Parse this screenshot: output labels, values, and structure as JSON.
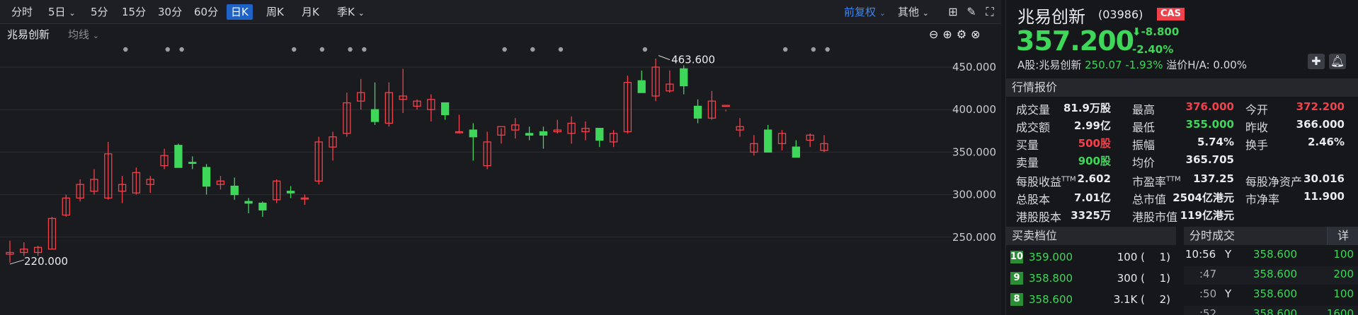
{
  "toolbar": {
    "periods": [
      "分时",
      "5日",
      "5分",
      "15分",
      "30分",
      "60分",
      "日K",
      "周K",
      "月K",
      "季K"
    ],
    "active": "日K",
    "adjust": "前复权",
    "other": "其他"
  },
  "chart": {
    "name": "兆易创新",
    "indicator": "均线",
    "yticks": [
      "450.000",
      "400.000",
      "350.000",
      "300.000",
      "250.000"
    ],
    "high_label": "463.600",
    "low_label": "220.000",
    "candles": [
      [
        230,
        246,
        220,
        232
      ],
      [
        232,
        244,
        228,
        236
      ],
      [
        232,
        240,
        228,
        238
      ],
      [
        236,
        274,
        236,
        272
      ],
      [
        276,
        300,
        274,
        296
      ],
      [
        296,
        318,
        292,
        312
      ],
      [
        304,
        330,
        300,
        318
      ],
      [
        296,
        362,
        294,
        348
      ],
      [
        304,
        322,
        290,
        312
      ],
      [
        302,
        332,
        300,
        326
      ],
      [
        312,
        322,
        302,
        318
      ],
      [
        334,
        354,
        330,
        346
      ],
      [
        358,
        360,
        336,
        332
      ],
      [
        338,
        345,
        330,
        337
      ],
      [
        332,
        336,
        300,
        310
      ],
      [
        312,
        322,
        306,
        316
      ],
      [
        310,
        320,
        294,
        300
      ],
      [
        292,
        296,
        278,
        290
      ],
      [
        290,
        292,
        274,
        282
      ],
      [
        294,
        318,
        290,
        316
      ],
      [
        304,
        310,
        296,
        302
      ],
      [
        296,
        300,
        288,
        296
      ],
      [
        316,
        368,
        312,
        362
      ],
      [
        356,
        374,
        340,
        368
      ],
      [
        372,
        420,
        368,
        408
      ],
      [
        410,
        436,
        400,
        420
      ],
      [
        400,
        432,
        382,
        386
      ],
      [
        384,
        432,
        380,
        420
      ],
      [
        412,
        448,
        396,
        416
      ],
      [
        404,
        412,
        400,
        410
      ],
      [
        400,
        418,
        386,
        412
      ],
      [
        408,
        408,
        388,
        394
      ],
      [
        374,
        394,
        372,
        374
      ],
      [
        376,
        384,
        340,
        368
      ],
      [
        334,
        374,
        330,
        362
      ],
      [
        370,
        378,
        360,
        380
      ],
      [
        376,
        390,
        366,
        382
      ],
      [
        372,
        380,
        364,
        370
      ],
      [
        374,
        380,
        354,
        370
      ],
      [
        374,
        388,
        372,
        376
      ],
      [
        372,
        392,
        360,
        384
      ],
      [
        374,
        386,
        364,
        378
      ],
      [
        378,
        374,
        356,
        364
      ],
      [
        362,
        376,
        356,
        372
      ],
      [
        374,
        440,
        372,
        432
      ],
      [
        434,
        446,
        420,
        420
      ],
      [
        416,
        460,
        410,
        450
      ],
      [
        422,
        446,
        420,
        430
      ],
      [
        448,
        452,
        418,
        428
      ],
      [
        404,
        412,
        384,
        390
      ],
      [
        390,
        422,
        388,
        410
      ],
      [
        405,
        400,
        398,
        405
      ],
      [
        376,
        390,
        368,
        380
      ],
      [
        350,
        370,
        346,
        360
      ],
      [
        376,
        382,
        350,
        350
      ],
      [
        360,
        376,
        352,
        372
      ],
      [
        356,
        364,
        346,
        344
      ],
      [
        364,
        372,
        356,
        370
      ],
      [
        352,
        370,
        350,
        360
      ]
    ]
  },
  "quote": {
    "name": "兆易创新",
    "code": "(03986)",
    "badge": "CAS",
    "price": "357.200",
    "change": "-8.800",
    "change_pct": "-2.40%",
    "a_share": "A股:兆易创新",
    "a_price": "250.07",
    "a_pct": "-1.93%",
    "premium": "溢价H/A: 0.00%"
  },
  "market": {
    "title": "行情报价",
    "rows": [
      [
        [
          "成交量",
          "81.9万股",
          "white"
        ],
        [
          "最高",
          "376.000",
          "red"
        ],
        [
          "今开",
          "372.200",
          "red"
        ]
      ],
      [
        [
          "成交额",
          "2.99亿",
          "white"
        ],
        [
          "最低",
          "355.000",
          "green"
        ],
        [
          "昨收",
          "366.000",
          "white"
        ]
      ],
      [
        [
          "买量",
          "500股",
          "red"
        ],
        [
          "振幅",
          "5.74%",
          "white"
        ],
        [
          "换手",
          "2.46%",
          "white"
        ]
      ],
      [
        [
          "卖量",
          "900股",
          "green"
        ],
        [
          "均价",
          "365.705",
          "white"
        ],
        [
          "",
          "",
          " "
        ]
      ]
    ],
    "fund_rows": [
      [
        [
          "每股收益",
          "2.602"
        ],
        [
          "市盈率",
          "137.25"
        ],
        [
          "每股净资产",
          "30.016"
        ]
      ],
      [
        [
          "总股本",
          "7.01亿"
        ],
        [
          "总市值",
          "2504亿港元"
        ],
        [
          "市净率",
          "11.900"
        ]
      ],
      [
        [
          "港股股本",
          "3325万"
        ],
        [
          "港股市值",
          "119亿港元"
        ],
        [
          "",
          ""
        ]
      ]
    ],
    "ttm": "TTM"
  },
  "orderbook": {
    "title": "买卖档位",
    "rows": [
      {
        "level": "10",
        "price": "359.000",
        "vol": "100 (",
        "cnt": "1)"
      },
      {
        "level": "9",
        "price": "358.800",
        "vol": "300 (",
        "cnt": "1)"
      },
      {
        "level": "8",
        "price": "358.600",
        "vol": "3.1K (",
        "cnt": "2)"
      }
    ]
  },
  "trades": {
    "title": "分时成交",
    "detail": "详",
    "rows": [
      {
        "time": "10:56",
        "flag": "Y",
        "price": "358.600",
        "vol": "100"
      },
      {
        "time": ":47",
        "flag": "",
        "price": "358.600",
        "vol": "200"
      },
      {
        "time": ":50",
        "flag": "Y",
        "price": "358.600",
        "vol": "100"
      },
      {
        "time": ":52",
        "flag": "",
        "price": "358.600",
        "vol": "1600"
      }
    ]
  },
  "colors": {
    "up": "#f0424c",
    "down": "#3ed75a",
    "accent": "#1f63c6"
  }
}
